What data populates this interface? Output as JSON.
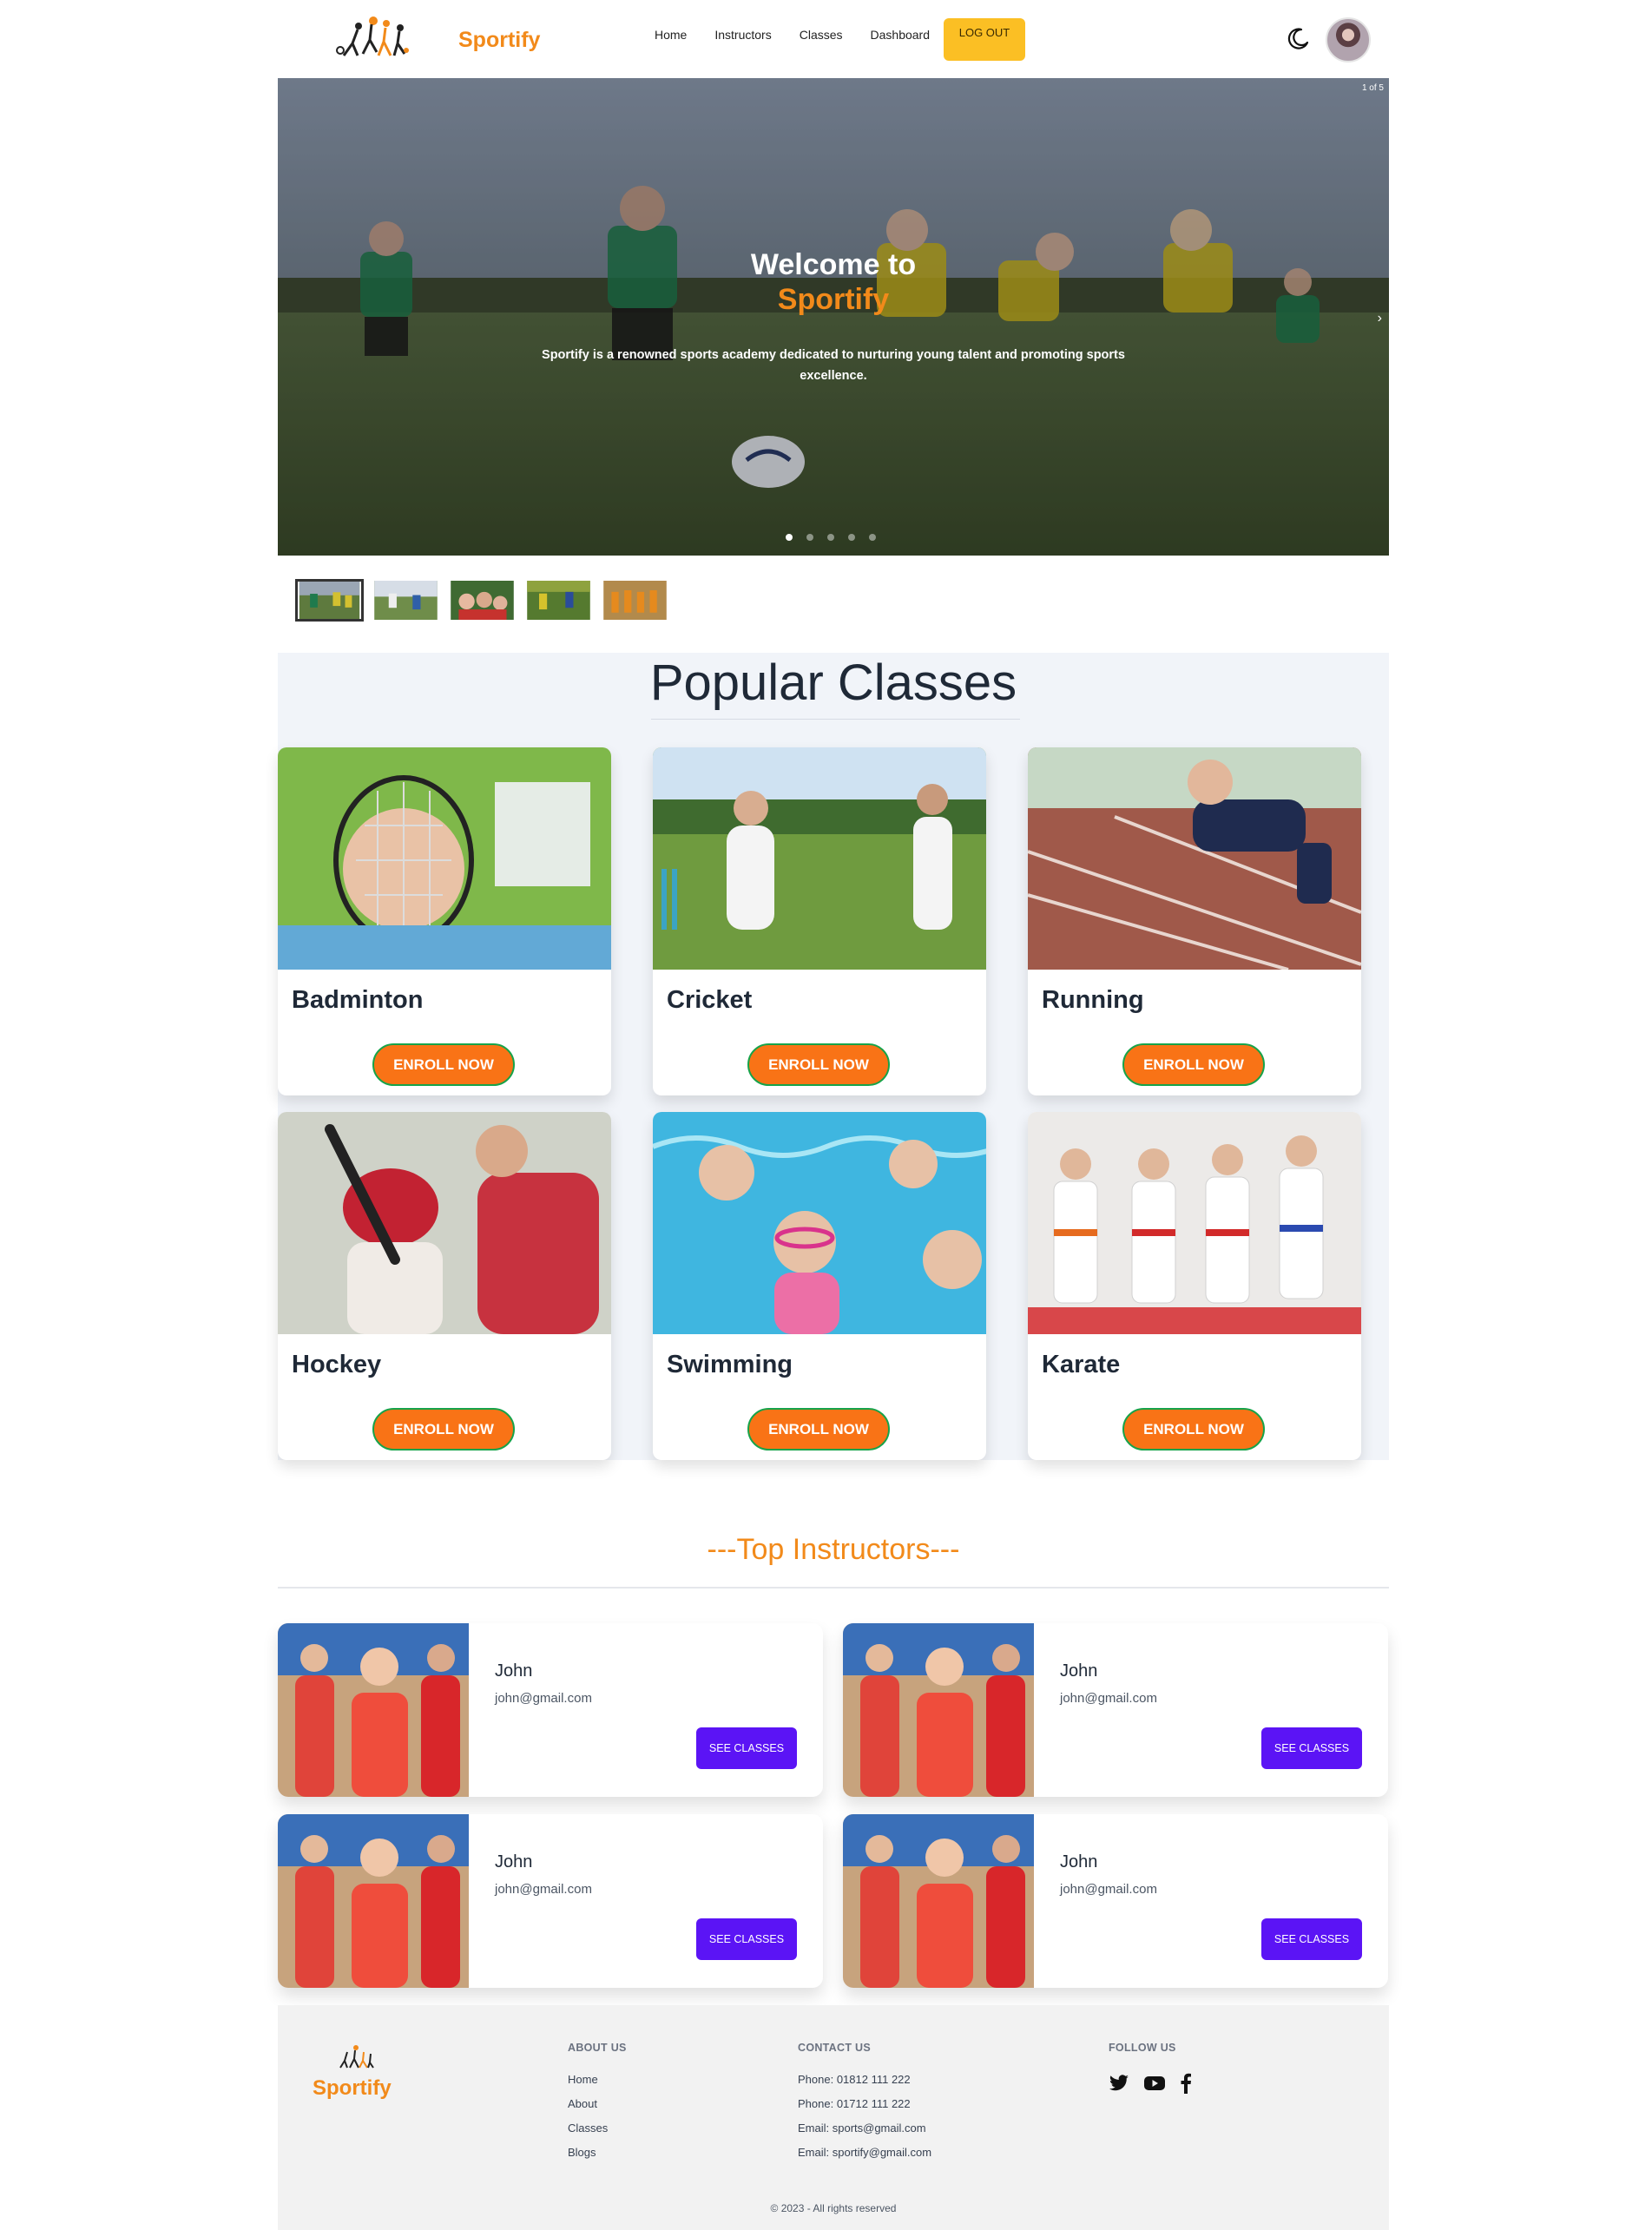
{
  "nav": {
    "brand": "Sportify",
    "links": [
      "Home",
      "Instructors",
      "Classes",
      "Dashboard"
    ],
    "logout_label": "LOG OUT",
    "theme_icon": "moon-icon",
    "avatar_icon": "user-avatar"
  },
  "hero": {
    "counter": "1 of 5",
    "title_line1": "Welcome to",
    "title_line2": "Sportify",
    "description": "Sportify is a renowned sports academy dedicated to nurturing young talent and promoting sports excellence.",
    "slide_count": 5,
    "active_slide": 1,
    "next_icon": "chevron-right-icon"
  },
  "classes": {
    "title": "Popular Classes",
    "enroll_label": "ENROLL NOW",
    "items": [
      {
        "name": "Badminton"
      },
      {
        "name": "Cricket"
      },
      {
        "name": "Running"
      },
      {
        "name": "Hockey"
      },
      {
        "name": "Swimming"
      },
      {
        "name": "Karate"
      }
    ]
  },
  "instructors": {
    "title": "---Top Instructors---",
    "button_label": "SEE CLASSES",
    "items": [
      {
        "name": "John",
        "email": "john@gmail.com"
      },
      {
        "name": "John",
        "email": "john@gmail.com"
      },
      {
        "name": "John",
        "email": "john@gmail.com"
      },
      {
        "name": "John",
        "email": "john@gmail.com"
      }
    ]
  },
  "footer": {
    "brand": "Sportify",
    "about": {
      "heading": "ABOUT US",
      "links": [
        "Home",
        "About",
        "Classes",
        "Blogs"
      ]
    },
    "contact": {
      "heading": "CONTACT US",
      "lines": [
        "Phone: 01812 111 222",
        "Phone: 01712 111 222",
        "Email: sports@gmail.com",
        "Email: sportify@gmail.com"
      ]
    },
    "follow": {
      "heading": "FOLLOW US",
      "icons": [
        "twitter-icon",
        "youtube-icon",
        "facebook-icon"
      ]
    },
    "copyright": "© 2023 - All rights reserved"
  },
  "colors": {
    "brand_orange": "#f28a1a",
    "enroll_orange": "#f97316",
    "logout_yellow": "#fbbf24",
    "see_classes_purple": "#5b14f5",
    "classes_bg": "#f1f4f9"
  }
}
